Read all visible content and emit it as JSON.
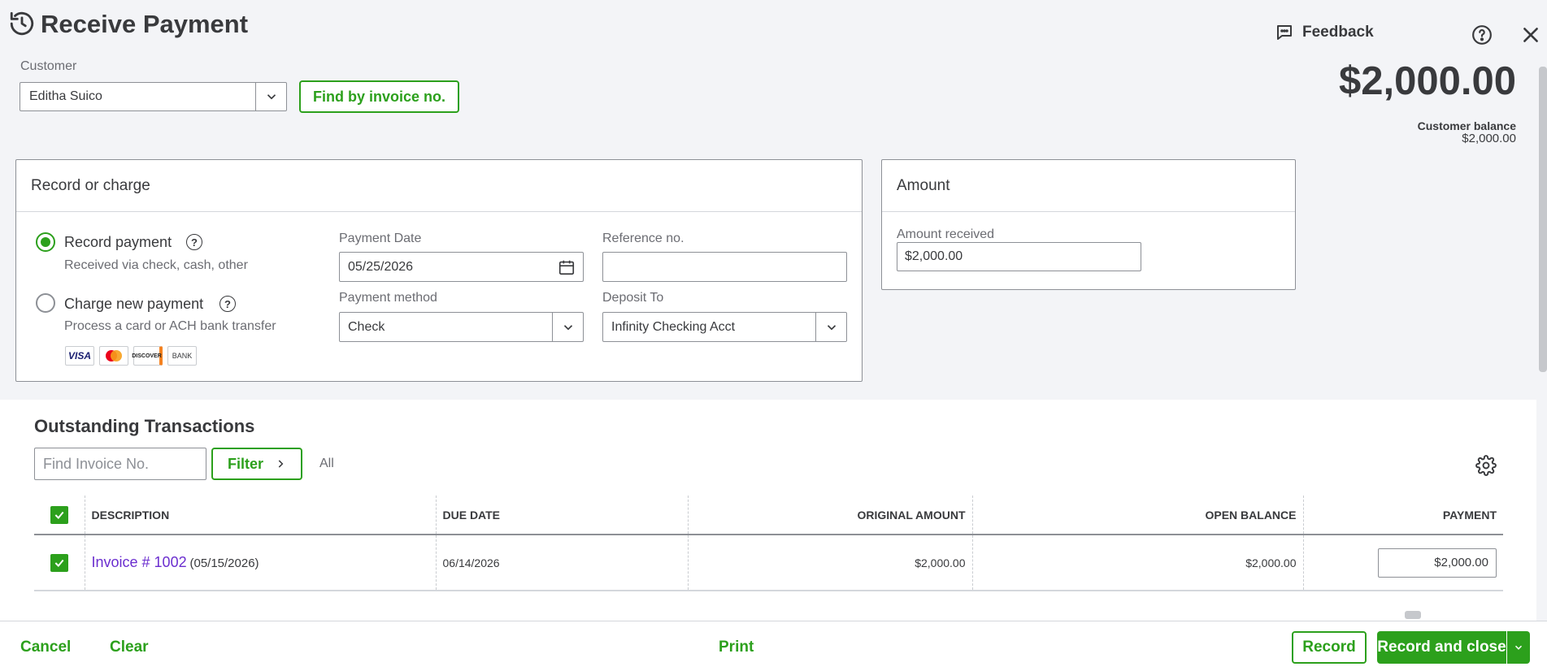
{
  "header": {
    "title": "Receive Payment",
    "feedback_label": "Feedback",
    "icons": [
      "history-icon",
      "feedback-icon",
      "help-icon",
      "close-icon"
    ]
  },
  "customer": {
    "label": "Customer",
    "value": "Editha Suico",
    "find_button": "Find by invoice no."
  },
  "summary": {
    "amount": "$2,000.00",
    "balance_label": "Customer balance",
    "balance_value": "$2,000.00"
  },
  "record_or_charge": {
    "title": "Record or charge",
    "record_payment": {
      "label": "Record payment",
      "sub": "Received via check, cash, other",
      "selected": true
    },
    "charge_new": {
      "label": "Charge new payment",
      "sub": "Process a card or ACH bank transfer",
      "selected": false
    },
    "badges": [
      "VISA",
      "",
      "DISCOVER",
      "BANK"
    ],
    "payment_date": {
      "label": "Payment Date",
      "value": "05/25/2026"
    },
    "reference": {
      "label": "Reference no.",
      "value": ""
    },
    "payment_method": {
      "label": "Payment method",
      "value": "Check"
    },
    "deposit_to": {
      "label": "Deposit To",
      "value": "Infinity Checking Acct"
    }
  },
  "amount_card": {
    "title": "Amount",
    "received_label": "Amount received",
    "received_value": "$2,000.00"
  },
  "outstanding": {
    "title": "Outstanding Transactions",
    "find_placeholder": "Find Invoice No.",
    "filter_label": "Filter",
    "all_label": "All",
    "columns": [
      "DESCRIPTION",
      "DUE DATE",
      "ORIGINAL AMOUNT",
      "OPEN BALANCE",
      "PAYMENT"
    ],
    "rows": [
      {
        "checked": true,
        "invoice": "Invoice # 1002",
        "invoice_date": "(05/15/2026)",
        "due_date": "06/14/2026",
        "original_amount": "$2,000.00",
        "open_balance": "$2,000.00",
        "payment": "$2,000.00"
      }
    ]
  },
  "footer": {
    "cancel": "Cancel",
    "clear": "Clear",
    "print": "Print",
    "record": "Record",
    "record_and_close": "Record and close"
  },
  "colors": {
    "brand_green": "#2ca01c",
    "link_purple": "#6b2ecf",
    "text": "#393a3d",
    "muted": "#6b6c72",
    "bg": "#f3f4f7"
  }
}
